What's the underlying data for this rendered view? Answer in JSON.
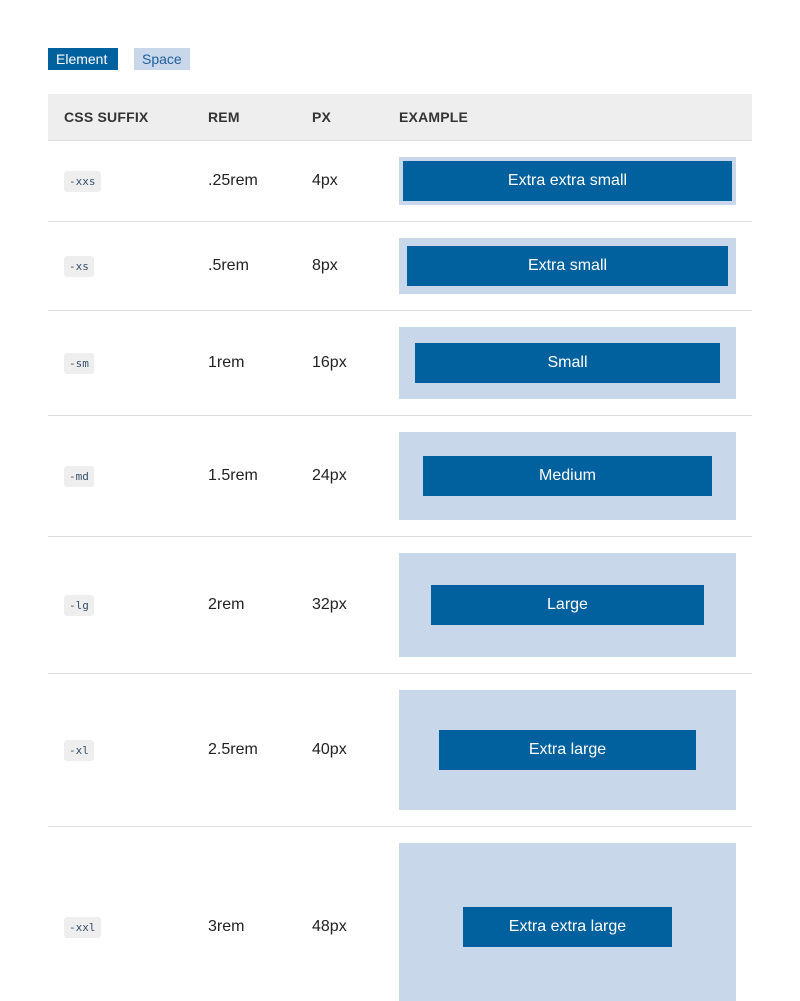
{
  "legend": {
    "element_label": "Element",
    "space_label": "Space"
  },
  "table": {
    "headers": {
      "suffix": "CSS SUFFIX",
      "rem": "REM",
      "px": "PX",
      "example": "EXAMPLE"
    },
    "rows": [
      {
        "suffix": "-xxs",
        "rem": ".25rem",
        "px": "4px",
        "example": "Extra extra small"
      },
      {
        "suffix": "-xs",
        "rem": ".5rem",
        "px": "8px",
        "example": "Extra small"
      },
      {
        "suffix": "-sm",
        "rem": "1rem",
        "px": "16px",
        "example": "Small"
      },
      {
        "suffix": "-md",
        "rem": "1.5rem",
        "px": "24px",
        "example": "Medium"
      },
      {
        "suffix": "-lg",
        "rem": "2rem",
        "px": "32px",
        "example": "Large"
      },
      {
        "suffix": "-xl",
        "rem": "2.5rem",
        "px": "40px",
        "example": "Extra large"
      },
      {
        "suffix": "-xxl",
        "rem": "3rem",
        "px": "48px",
        "example": "Extra extra large"
      }
    ]
  },
  "colors": {
    "element": "#00619e",
    "space": "#c9d7ea"
  }
}
